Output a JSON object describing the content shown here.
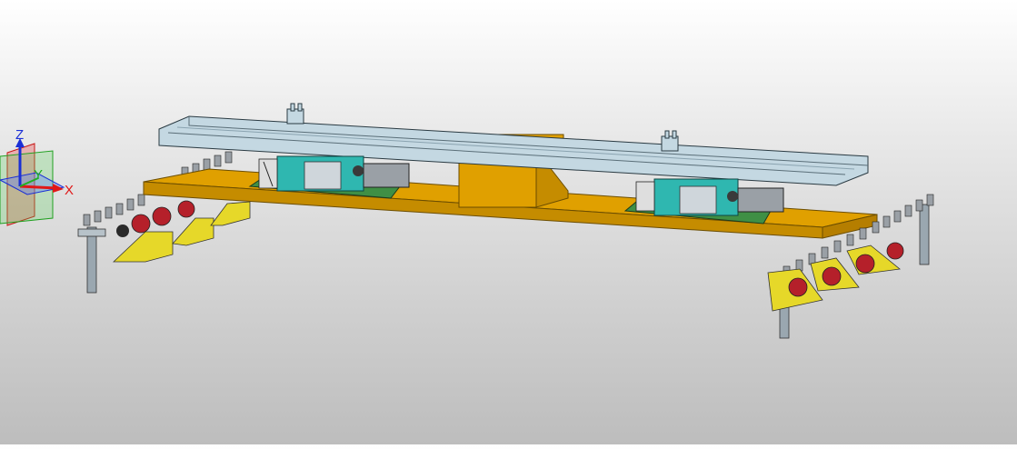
{
  "triad": {
    "x_label": "X",
    "y_label": "Y",
    "z_label": "Z",
    "x_color": "#e01818",
    "y_color": "#20b020",
    "z_color": "#1a2fd6"
  },
  "colors": {
    "beam": "#e0a000",
    "beam_dark": "#b57e00",
    "rail": "#c4d8e2",
    "rail_dark": "#8aa3b0",
    "motor_body": "#2fb7b0",
    "pcb": "#3f8f45",
    "bracket": "#e6d829",
    "wheel": "#b5202a",
    "post": "#9aa7b0"
  },
  "icons": {
    "triad": "axis-triad-icon"
  }
}
